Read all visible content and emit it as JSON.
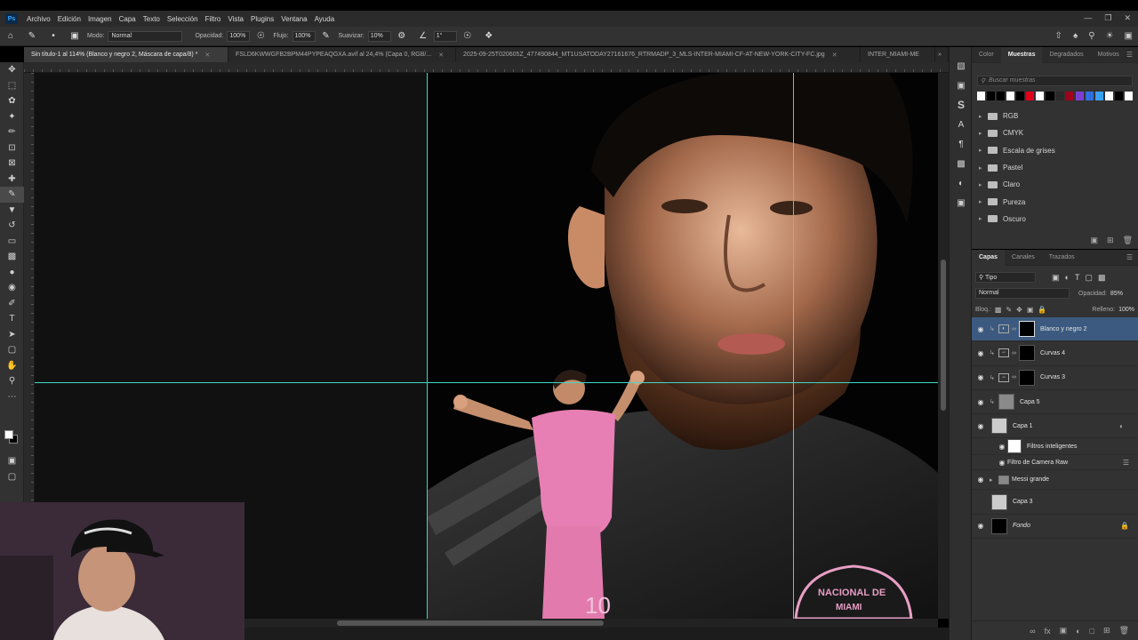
{
  "app": {
    "logo": "Ps"
  },
  "menu": [
    "Archivo",
    "Edición",
    "Imagen",
    "Capa",
    "Texto",
    "Selección",
    "Filtro",
    "Vista",
    "Plugins",
    "Ventana",
    "Ayuda"
  ],
  "options": {
    "mode_label": "Modo:",
    "mode_value": "Normal",
    "opacity_label": "Opacidad:",
    "opacity_value": "100%",
    "flow_label": "Flujo:",
    "flow_value": "100%",
    "smooth_label": "Suavizar:",
    "smooth_value": "10%",
    "angle_value": "1°"
  },
  "tabs": [
    {
      "label": "Sin título-1 al 114% (Blanco y negro 2, Máscara de capa/8) *"
    },
    {
      "label": "FSLD6KWWGFB2BPM44PYPEAQGXA.avif al 24,4% (Capa 0, RGB/..."
    },
    {
      "label": "2025-09-25T020605Z_477490844_MT1USATODAY27161676_RTRMADP_3_MLS-INTER-MIAMI-CF-AT-NEW-YORK-CITY-FC.jpg"
    },
    {
      "label": "INTER_MIAMI-ME"
    }
  ],
  "swatches_panel": {
    "tabs": [
      "Color",
      "Muestras",
      "Degradados",
      "Motivos"
    ],
    "search_placeholder": "Buscar muestras",
    "colors": [
      "#ffffff",
      "#000000",
      "#000000",
      "#ffffff",
      "#000000",
      "#e0001b",
      "#ffffff",
      "#000000",
      "#2a2a2a",
      "#a0001a",
      "#7a3fd0",
      "#2f6fe0",
      "#3aa0f0",
      "#ffffff",
      "#000000",
      "#ffffff"
    ],
    "groups": [
      "RGB",
      "CMYK",
      "Escala de grises",
      "Pastel",
      "Claro",
      "Pureza",
      "Oscuro"
    ]
  },
  "layers_panel": {
    "tabs": [
      "Capas",
      "Canales",
      "Trazados"
    ],
    "filter_value": "Tipo",
    "blend_value": "Normal",
    "opacity_label": "Opacidad:",
    "opacity_value": "85%",
    "lock_label": "Bloq.:",
    "fill_label": "Relleno:",
    "fill_value": "100%",
    "layers": [
      {
        "name": "Blanco y negro 2"
      },
      {
        "name": "Curvas 4"
      },
      {
        "name": "Curvas 3"
      },
      {
        "name": "Capa 5"
      },
      {
        "name": "Capa 1"
      },
      {
        "name": "Filtros inteligentes"
      },
      {
        "name": "Filtro de Camera Raw"
      },
      {
        "name": "Messi grande"
      },
      {
        "name": "Capa 3"
      },
      {
        "name": "Fondo"
      }
    ]
  },
  "canvas": {
    "jersey_number": "10",
    "badge_text_1": "NACIONAL DE",
    "badge_text_2": "MIAMI"
  },
  "colors": {
    "guide": "#3fd8c2",
    "selected_layer": "#3c5a80",
    "jersey_pink": "#e87fb4"
  }
}
